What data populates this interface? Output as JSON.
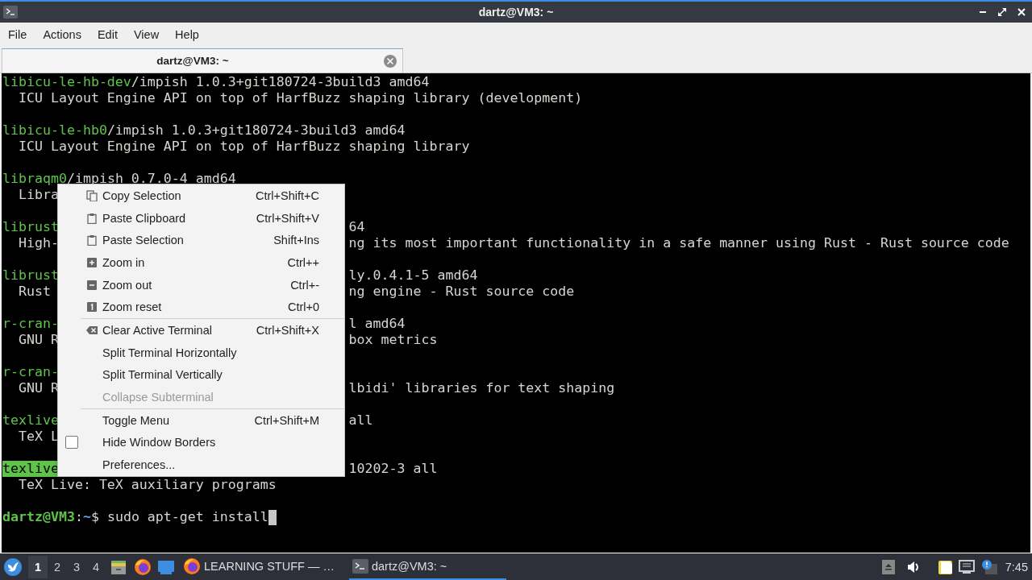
{
  "window": {
    "title": "dartz@VM3: ~"
  },
  "menu_bar": [
    "File",
    "Actions",
    "Edit",
    "View",
    "Help"
  ],
  "tabs": [
    {
      "label": "dartz@VM3: ~",
      "selected": true
    }
  ],
  "terminal": {
    "lines": [
      {
        "kind": "text",
        "left": [
          {
            "kind": "package",
            "text": "libicu-le-hb-dev"
          },
          {
            "kind": "plain",
            "text": "/impish 1.0.3+git180724-3build3 amd64"
          }
        ]
      },
      {
        "kind": "text",
        "left": [
          {
            "kind": "plain",
            "text": "  ICU Layout Engine API on top of HarfBuzz shaping library (development)"
          }
        ]
      },
      {
        "kind": "blank"
      },
      {
        "kind": "text",
        "left": [
          {
            "kind": "package",
            "text": "libicu-le-hb0"
          },
          {
            "kind": "plain",
            "text": "/impish 1.0.3+git180724-3build3 amd64"
          }
        ]
      },
      {
        "kind": "text",
        "left": [
          {
            "kind": "plain",
            "text": "  ICU Layout Engine API on top of HarfBuzz shaping library"
          }
        ]
      },
      {
        "kind": "blank"
      },
      {
        "kind": "text",
        "left": [
          {
            "kind": "package",
            "text": "libraqm0"
          },
          {
            "kind": "plain",
            "text": "/impish 0.7.0-4 amd64"
          }
        ]
      },
      {
        "kind": "text",
        "left": [
          {
            "kind": "plain",
            "text": "  Libra"
          }
        ]
      },
      {
        "kind": "blank"
      },
      {
        "kind": "text",
        "left": [
          {
            "kind": "package",
            "text": "librust"
          }
        ],
        "right": [
          {
            "kind": "plain",
            "text": "64"
          }
        ]
      },
      {
        "kind": "text",
        "left": [
          {
            "kind": "plain",
            "text": "  High-"
          }
        ],
        "right": [
          {
            "kind": "plain",
            "text": "ng its most important functionality in a safe manner using Rust - Rust source code"
          }
        ]
      },
      {
        "kind": "blank"
      },
      {
        "kind": "text",
        "left": [
          {
            "kind": "package",
            "text": "librust"
          }
        ],
        "right": [
          {
            "kind": "plain",
            "text": "ly.0.4.1-5 amd64"
          }
        ]
      },
      {
        "kind": "text",
        "left": [
          {
            "kind": "plain",
            "text": "  Rust"
          }
        ],
        "right": [
          {
            "kind": "plain",
            "text": "ng engine - Rust source code"
          }
        ]
      },
      {
        "kind": "blank"
      },
      {
        "kind": "text",
        "left": [
          {
            "kind": "package",
            "text": "r-cran-"
          }
        ],
        "right": [
          {
            "kind": "plain",
            "text": "l amd64"
          }
        ]
      },
      {
        "kind": "text",
        "left": [
          {
            "kind": "plain",
            "text": "  GNU R"
          }
        ],
        "right": [
          {
            "kind": "plain",
            "text": "box metrics"
          }
        ]
      },
      {
        "kind": "blank"
      },
      {
        "kind": "text",
        "left": [
          {
            "kind": "package",
            "text": "r-cran-"
          }
        ]
      },
      {
        "kind": "text",
        "left": [
          {
            "kind": "plain",
            "text": "  GNU R"
          }
        ],
        "right": [
          {
            "kind": "plain",
            "text": "lbidi' libraries for text shaping"
          }
        ]
      },
      {
        "kind": "blank"
      },
      {
        "kind": "text",
        "left": [
          {
            "kind": "package",
            "text": "texlive"
          }
        ],
        "right": [
          {
            "kind": "plain",
            "text": "all"
          }
        ]
      },
      {
        "kind": "text",
        "left": [
          {
            "kind": "plain",
            "text": "  TeX L"
          }
        ]
      },
      {
        "kind": "blank"
      },
      {
        "kind": "text",
        "left": [
          {
            "kind": "highlight",
            "text": "texlive"
          }
        ],
        "right": [
          {
            "kind": "plain",
            "text": "10202-3 all"
          }
        ]
      },
      {
        "kind": "text",
        "left": [
          {
            "kind": "plain",
            "text": "  TeX Live: TeX auxiliary programs"
          }
        ]
      },
      {
        "kind": "blank"
      }
    ],
    "prompt": {
      "user_host": "dartz@VM3",
      "separator": ":",
      "path": "~",
      "symbol": "$",
      "command": "sudo apt-get install"
    }
  },
  "context_menu": [
    {
      "kind": "action",
      "label": "Copy Selection",
      "shortcut": "Ctrl+Shift+C",
      "disabled": false
    },
    {
      "kind": "action",
      "label": "Paste Clipboard",
      "shortcut": "Ctrl+Shift+V",
      "disabled": false
    },
    {
      "kind": "action",
      "label": "Paste Selection",
      "shortcut": "Shift+Ins",
      "disabled": false
    },
    {
      "kind": "action",
      "label": "Zoom in",
      "shortcut": "Ctrl++",
      "disabled": false
    },
    {
      "kind": "action",
      "label": "Zoom out",
      "shortcut": "Ctrl+-",
      "disabled": false
    },
    {
      "kind": "action",
      "label": "Zoom reset",
      "shortcut": "Ctrl+0",
      "disabled": false
    },
    {
      "kind": "separator"
    },
    {
      "kind": "action",
      "label": "Clear Active Terminal",
      "shortcut": "Ctrl+Shift+X",
      "disabled": false
    },
    {
      "kind": "action",
      "label": "Split Terminal Horizontally",
      "disabled": false
    },
    {
      "kind": "action",
      "label": "Split Terminal Vertically",
      "disabled": false
    },
    {
      "kind": "action",
      "label": "Collapse Subterminal",
      "disabled": true
    },
    {
      "kind": "separator"
    },
    {
      "kind": "action",
      "label": "Toggle Menu",
      "shortcut": "Ctrl+Shift+M",
      "disabled": false
    },
    {
      "kind": "check",
      "label": "Hide Window Borders",
      "checked": false,
      "disabled": false
    },
    {
      "kind": "action",
      "label": "Preferences...",
      "disabled": false
    }
  ],
  "taskbar": {
    "workspaces": [
      {
        "label": "1",
        "selected": true
      },
      {
        "label": "2",
        "selected": false
      },
      {
        "label": "3",
        "selected": false
      },
      {
        "label": "4",
        "selected": false
      }
    ],
    "tasks": [
      {
        "kind": "browser",
        "label": "LEARNING STUFF — …",
        "selected": false
      },
      {
        "kind": "terminal",
        "label": "dartz@VM3: ~",
        "selected": true
      }
    ],
    "clock": "7:45"
  }
}
